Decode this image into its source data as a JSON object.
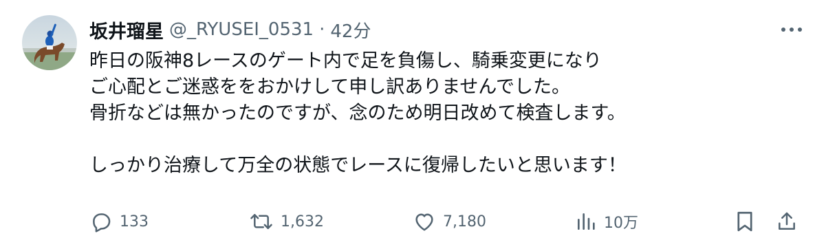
{
  "tweet": {
    "display_name": "坂井瑠星",
    "handle": "@_RYUSEI_0531",
    "separator": "·",
    "time": "42分",
    "lines": [
      "昨日の阪神8レースのゲート内で足を負傷し、騎乗変更になり",
      "ご心配とご迷惑ををおかけして申し訳ありませんでした。",
      "骨折などは無かったのですが、念のため明日改めて検査します。",
      "",
      "しっかり治療して万全の状態でレースに復帰したいと思います！"
    ]
  },
  "actions": {
    "reply_count": "133",
    "retweet_count": "1,632",
    "like_count": "7,180",
    "views_count": "10万"
  },
  "icons": {
    "more": "more-icon",
    "reply": "reply-icon",
    "retweet": "retweet-icon",
    "like": "like-icon",
    "views": "views-icon",
    "bookmark": "bookmark-icon",
    "share": "share-icon"
  },
  "colors": {
    "text_primary": "#0f1419",
    "text_secondary": "#536471"
  }
}
